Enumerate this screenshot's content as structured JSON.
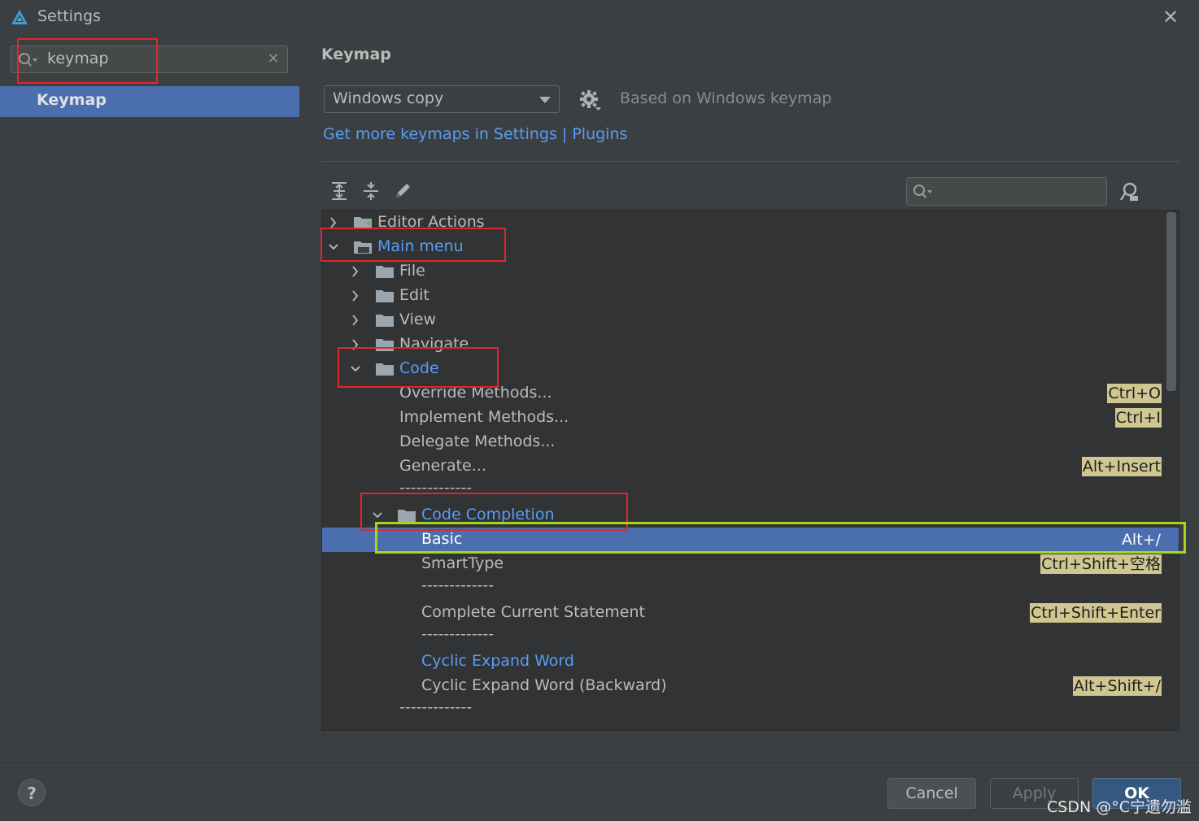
{
  "window": {
    "title": "Settings"
  },
  "sidebar": {
    "search_value": "keymap",
    "items": [
      {
        "label": "Keymap",
        "selected": true
      }
    ]
  },
  "main": {
    "title": "Keymap",
    "keymap_select": "Windows copy",
    "based_on": "Based on Windows keymap",
    "more_link": "Get more keymaps in Settings | Plugins",
    "toolbar": {
      "icons": [
        "expand-all-icon",
        "collapse-all-icon",
        "edit-icon"
      ],
      "search_placeholder": "",
      "find_by_shortcut_icon": "find-shortcut-icon"
    },
    "tree": [
      {
        "label": "Editor Actions",
        "expanded": false,
        "type": "folder-special",
        "level": 0
      },
      {
        "label": "Main menu",
        "expanded": true,
        "type": "folder-menu",
        "level": 0,
        "highlight": true
      },
      {
        "label": "File",
        "expanded": false,
        "type": "folder",
        "level": 1
      },
      {
        "label": "Edit",
        "expanded": false,
        "type": "folder",
        "level": 1
      },
      {
        "label": "View",
        "expanded": false,
        "type": "folder",
        "level": 1
      },
      {
        "label": "Navigate",
        "expanded": false,
        "type": "folder",
        "level": 1
      },
      {
        "label": "Code",
        "expanded": true,
        "type": "folder",
        "level": 1,
        "highlight": true
      },
      {
        "label": "Override Methods...",
        "type": "action",
        "level": 2,
        "shortcut": "Ctrl+O"
      },
      {
        "label": "Implement Methods...",
        "type": "action",
        "level": 2,
        "shortcut": "Ctrl+I"
      },
      {
        "label": "Delegate Methods...",
        "type": "action",
        "level": 2,
        "shortcut": ""
      },
      {
        "label": "Generate...",
        "type": "action",
        "level": 2,
        "shortcut": "Alt+Insert"
      },
      {
        "label": "-------------",
        "type": "separator",
        "level": 2
      },
      {
        "label": "Code Completion",
        "expanded": true,
        "type": "folder",
        "level": 2,
        "highlight": true
      },
      {
        "label": "Basic",
        "type": "action",
        "level": 3,
        "shortcut": "Alt+/",
        "selected": true
      },
      {
        "label": "SmartType",
        "type": "action",
        "level": 3,
        "shortcut": "Ctrl+Shift+空格"
      },
      {
        "label": "-------------",
        "type": "separator",
        "level": 3
      },
      {
        "label": "Complete Current Statement",
        "type": "action",
        "level": 3,
        "shortcut": "Ctrl+Shift+Enter"
      },
      {
        "label": "-------------",
        "type": "separator",
        "level": 3
      },
      {
        "label": "Cyclic Expand Word",
        "type": "action",
        "level": 3,
        "shortcut": "",
        "highlight": true
      },
      {
        "label": "Cyclic Expand Word (Backward)",
        "type": "action",
        "level": 3,
        "shortcut": "Alt+Shift+/"
      },
      {
        "label": "-------------",
        "type": "separator",
        "level": 2
      }
    ]
  },
  "footer": {
    "help": "?",
    "cancel": "Cancel",
    "apply": "Apply",
    "ok": "OK"
  },
  "watermark": "CSDN @°C宁遗勿滥",
  "colors": {
    "background": "#3c3f41",
    "tree_background": "#313335",
    "selection": "#4b6eaf",
    "link": "#589df6",
    "shortcut_badge": "#d0c690",
    "annotation_red": "#e0282b",
    "annotation_green": "#a4d61b"
  }
}
